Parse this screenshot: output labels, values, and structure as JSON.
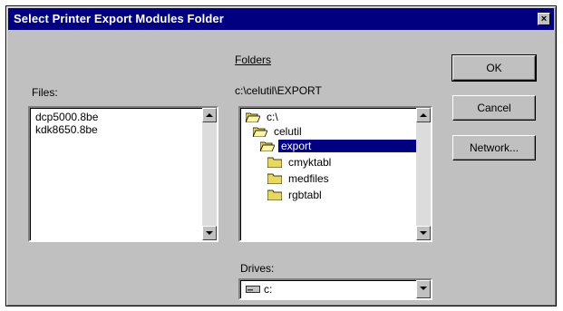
{
  "window": {
    "title": "Select Printer Export Modules Folder",
    "close_glyph": "×"
  },
  "files": {
    "label": "Files:",
    "items": [
      "dcp5000.8be",
      "kdk8650.8be"
    ]
  },
  "folders": {
    "label": "Folders",
    "current_path": "c:\\celutil\\EXPORT",
    "tree": [
      {
        "label": "c:\\",
        "icon": "open-folder-icon",
        "selected": false
      },
      {
        "label": "celutil",
        "icon": "open-folder-icon",
        "selected": false
      },
      {
        "label": "export",
        "icon": "open-folder-icon",
        "selected": true
      },
      {
        "label": "cmyktabl",
        "icon": "folder-icon",
        "selected": false
      },
      {
        "label": "medfiles",
        "icon": "folder-icon",
        "selected": false
      },
      {
        "label": "rgbtabl",
        "icon": "folder-icon",
        "selected": false
      }
    ]
  },
  "drives": {
    "label": "Drives:",
    "selected": "c:",
    "icon": "drive-icon"
  },
  "buttons": {
    "ok": "OK",
    "cancel": "Cancel",
    "network": "Network..."
  },
  "colors": {
    "title_bar": "#000080",
    "dialog_face": "#c0c0c0",
    "selection": "#000080"
  }
}
